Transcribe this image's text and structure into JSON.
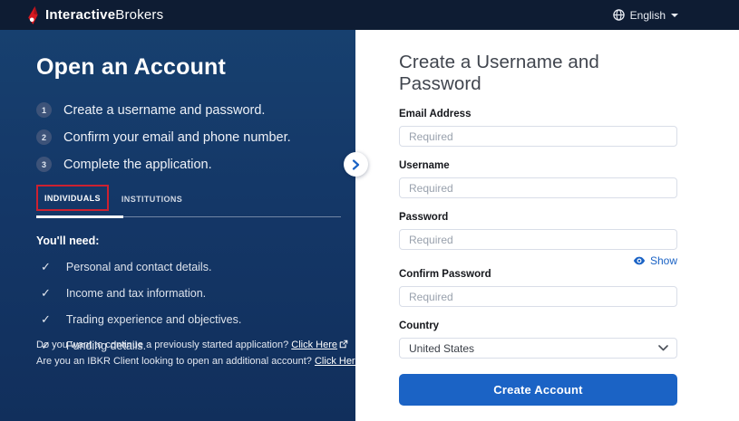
{
  "topbar": {
    "brand_bold": "Interactive",
    "brand_regular": "Brokers",
    "language_label": "English"
  },
  "left_panel": {
    "title": "Open an Account",
    "steps": [
      {
        "number": "1",
        "text": "Create a username and password."
      },
      {
        "number": "2",
        "text": "Confirm your email and phone number."
      },
      {
        "number": "3",
        "text": "Complete the application."
      }
    ],
    "tabs": {
      "individuals": "INDIVIDUALS",
      "institutions": "INSTITUTIONS"
    },
    "needs_title": "You'll need:",
    "needs": [
      {
        "check": "✓",
        "text": "Personal and contact details."
      },
      {
        "check": "✓",
        "text": "Income and tax information."
      },
      {
        "check": "✓",
        "text": "Trading experience and objectives."
      },
      {
        "check": "✓",
        "text": "Funding details."
      }
    ],
    "links": [
      {
        "question": "Do you want to continue a previously started application? ",
        "link": "Click Here"
      },
      {
        "question": "Are you an IBKR Client looking to open an additional account? ",
        "link": "Click Here"
      }
    ]
  },
  "form": {
    "title": "Create a Username and Password",
    "fields": {
      "email": {
        "label": "Email Address",
        "placeholder": "Required"
      },
      "username": {
        "label": "Username",
        "placeholder": "Required"
      },
      "password": {
        "label": "Password",
        "placeholder": "Required",
        "show_label": "Show"
      },
      "confirm_password": {
        "label": "Confirm Password",
        "placeholder": "Required"
      },
      "country": {
        "label": "Country",
        "value": "United States"
      }
    },
    "submit_label": "Create Account"
  },
  "colors": {
    "topbar_bg": "#0e1c33",
    "left_panel_bg": "#143767",
    "accent_blue": "#1b63c5",
    "highlight_red": "#cd2130",
    "brand_red": "#d71920"
  }
}
